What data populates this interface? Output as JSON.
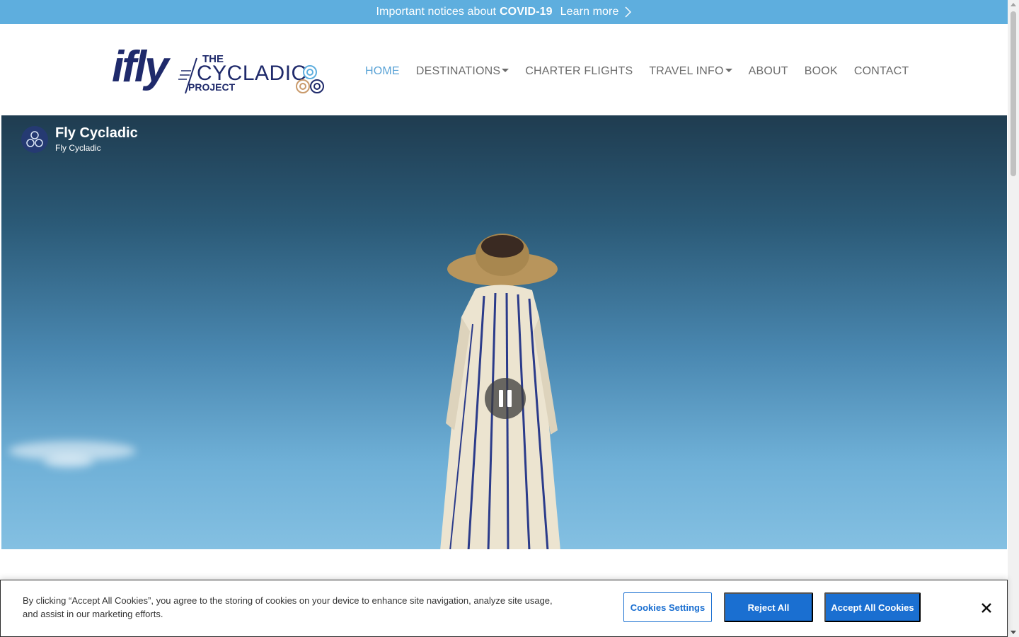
{
  "notice": {
    "text": "Important notices about",
    "bold": "COVID-19",
    "link": "Learn more"
  },
  "logo": {
    "brand": "ifly",
    "the": "THE",
    "cycladic": "CYCLADIC",
    "project": "PROJECT"
  },
  "nav": {
    "items": [
      {
        "label": "HOME",
        "active": true
      },
      {
        "label": "DESTINATIONS",
        "dropdown": true
      },
      {
        "label": "CHARTER FLIGHTS"
      },
      {
        "label": "TRAVEL INFO",
        "dropdown": true
      },
      {
        "label": "ABOUT"
      },
      {
        "label": "BOOK"
      },
      {
        "label": "CONTACT"
      }
    ]
  },
  "video": {
    "channel_title": "Fly Cycladic",
    "channel_subtitle": "Fly Cycladic"
  },
  "cookie": {
    "message": "By clicking “Accept All Cookies”, you agree to the storing of cookies on your device to enhance site navigation, analyze site usage, and assist in our marketing efforts.",
    "settings_label": "Cookies Settings",
    "reject_label": "Reject All",
    "accept_label": "Accept All Cookies"
  },
  "colors": {
    "notice_bg": "#5eaede",
    "brand_navy": "#1f2a6b",
    "nav_active": "#5aa3d6",
    "button_blue": "#1a6fd1"
  }
}
